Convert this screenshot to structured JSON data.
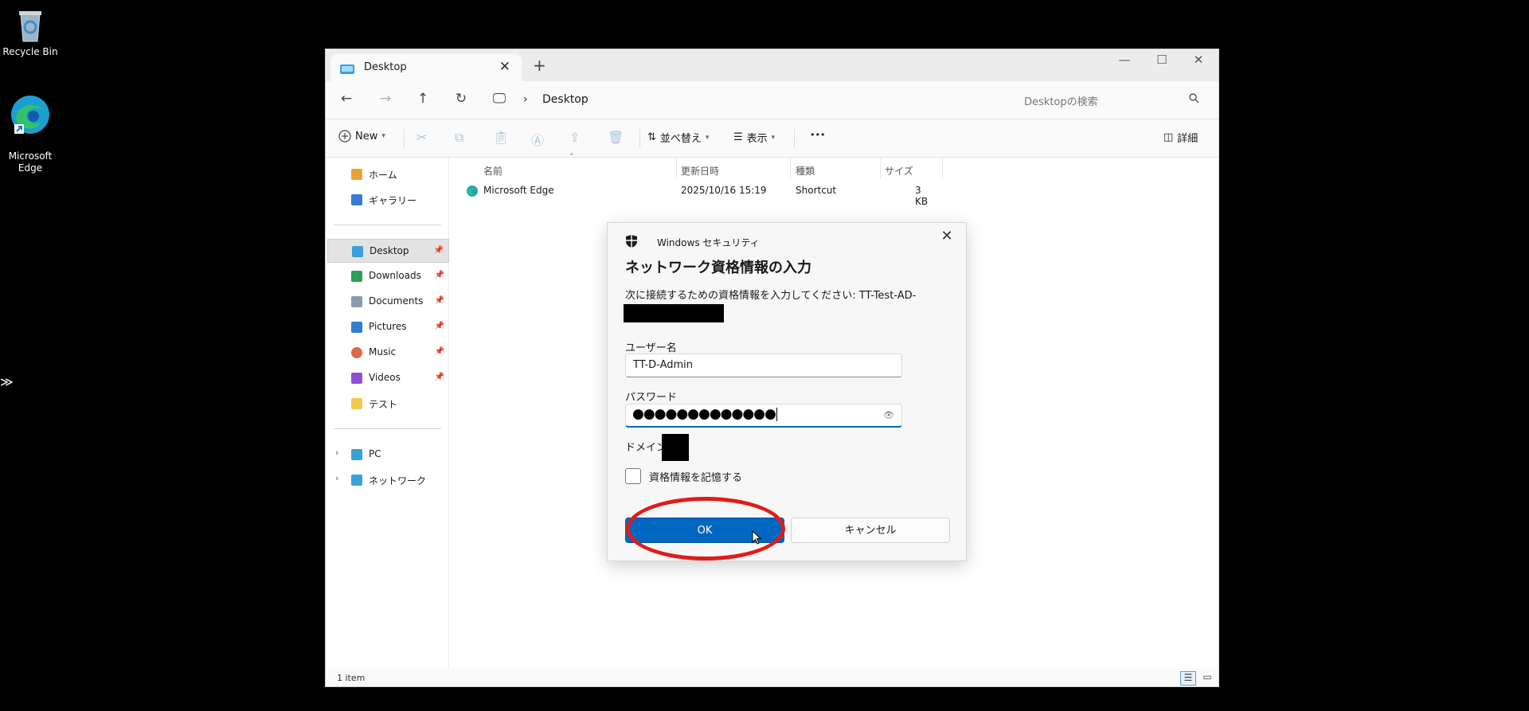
{
  "desktop": {
    "icons": [
      {
        "label": "Recycle Bin",
        "icon": "recycle-bin-icon"
      },
      {
        "label": "Microsoft\nEdge",
        "icon": "edge-icon"
      }
    ],
    "side_glyph": "≫"
  },
  "window": {
    "tab_title": "Desktop",
    "tab_close": "✕",
    "new_tab": "+",
    "controls": {
      "minimize": "—",
      "maximize": "☐",
      "close": "✕"
    },
    "nav": {
      "back": "←",
      "forward": "→",
      "up": "↑",
      "refresh": "↻",
      "pc_glyph": "🖵",
      "separator": "›"
    },
    "breadcrumb": "Desktop",
    "search_placeholder": "Desktopの検索",
    "toolbar": {
      "new_label": "New",
      "sort_label": "並べ替え",
      "view_label": "表示",
      "more": "•••",
      "details_label": "詳細"
    },
    "sidebar": {
      "items": [
        {
          "label": "ホーム",
          "color": "#e8a23c"
        },
        {
          "label": "ギャラリー",
          "color": "#3a7bd5"
        },
        {
          "label": "Desktop",
          "color": "#3aa0d8",
          "pinned": true
        },
        {
          "label": "Downloads",
          "color": "#2e9e5b",
          "pinned": true
        },
        {
          "label": "Documents",
          "color": "#8a9bb0",
          "pinned": true
        },
        {
          "label": "Pictures",
          "color": "#2d7fd0",
          "pinned": true
        },
        {
          "label": "Music",
          "color": "#e0684b",
          "pinned": true
        },
        {
          "label": "Videos",
          "color": "#8f4fd0",
          "pinned": true
        },
        {
          "label": "テスト",
          "color": "#f2c84b"
        },
        {
          "label": "PC",
          "color": "#3aa0d8"
        },
        {
          "label": "ネットワーク",
          "color": "#3aa0d8"
        }
      ],
      "pin_glyph": "📌",
      "expand_glyph": "›"
    },
    "columns": [
      "名前",
      "更新日時",
      "種類",
      "サイズ"
    ],
    "files": [
      {
        "name": "Microsoft Edge",
        "modified": "2025/10/16 15:19",
        "type": "Shortcut",
        "size": "3 KB"
      }
    ],
    "status": "1 item"
  },
  "dialog": {
    "app_name": "Windows セキュリティ",
    "close": "✕",
    "title": "ネットワーク資格情報の入力",
    "message": "次に接続するための資格情報を入力してください: TT-Test-AD-",
    "username_label": "ユーザー名",
    "username_value": "TT-D-Admin",
    "password_label": "パスワード",
    "password_masked": "●●●●●●●●●●●●●",
    "reveal_glyph": "👁",
    "domain_label": "ドメイン:",
    "remember_label": "資格情報を記憶する",
    "ok_label": "OK",
    "cancel_label": "キャンセル"
  },
  "colors": {
    "accent": "#0067c0",
    "highlight": "#e01b1b"
  }
}
